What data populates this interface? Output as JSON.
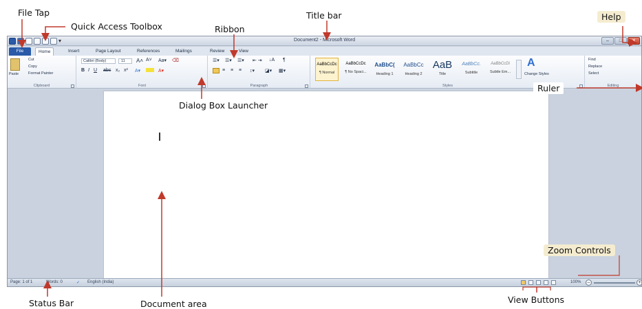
{
  "labels": {
    "file_tab": "File Tap",
    "quick_access": "Quick Access Toolbox",
    "ribbon": "Ribbon",
    "title_bar": "Title bar",
    "help": "Help",
    "ruler": "Ruler",
    "dialog_launcher": "Dialog Box Launcher",
    "zoom_controls": "Zoom Controls",
    "status_bar": "Status Bar",
    "document_area": "Document area",
    "view_buttons": "View Buttons"
  },
  "window": {
    "title": "Document2 - Microsoft Word",
    "tabs": [
      "File",
      "Home",
      "Insert",
      "Page Layout",
      "References",
      "Mailings",
      "Review",
      "View"
    ]
  },
  "ribbon": {
    "clipboard": {
      "paste": "Paste",
      "cut": "Cut",
      "copy": "Copy",
      "format_painter": "Format Painter",
      "label": "Clipboard"
    },
    "font": {
      "name": "Calibri (Body)",
      "size": "11",
      "label": "Font"
    },
    "paragraph": {
      "label": "Paragraph"
    },
    "styles": {
      "label": "Styles",
      "items": [
        {
          "sample": "AaBbCcDc",
          "name": "¶ Normal"
        },
        {
          "sample": "AaBbCcDc",
          "name": "¶ No Spaci..."
        },
        {
          "sample": "AaBbC(",
          "name": "Heading 1"
        },
        {
          "sample": "AaBbCc",
          "name": "Heading 2"
        },
        {
          "sample": "AaB",
          "name": "Title"
        },
        {
          "sample": "AaBbCc.",
          "name": "Subtitle"
        },
        {
          "sample": "AaBbCcDi",
          "name": "Subtle Em..."
        }
      ],
      "change_styles": "Change Styles"
    },
    "editing": {
      "find": "Find",
      "replace": "Replace",
      "select": "Select",
      "label": "Editing"
    }
  },
  "statusbar": {
    "page": "Page: 1 of 1",
    "words": "Words: 0",
    "language": "English (India)",
    "zoom": "100%"
  },
  "colors": {
    "label_bg": "#f5ecd0",
    "file_tab": "#2a5aa8",
    "arrow": "#c0392b"
  }
}
